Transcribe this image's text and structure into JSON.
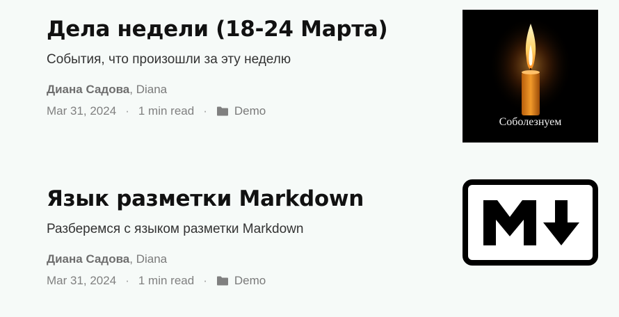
{
  "posts": [
    {
      "title": "Дела недели (18-24 Марта)",
      "summary": "События, что произошли за эту неделю",
      "author_main": "Диана Садова",
      "author_rest": ", Diana",
      "date": "Mar 31, 2024",
      "read_time": "1 min read",
      "separator": "·",
      "category": "Demo",
      "thumbnail": {
        "icon": "candle-icon",
        "caption": "Соболезнуем"
      }
    },
    {
      "title": "Язык разметки Markdown",
      "summary": "Разберемся с языком разметки Markdown",
      "author_main": "Диана Садова",
      "author_rest": ", Diana",
      "date": "Mar 31, 2024",
      "read_time": "1 min read",
      "separator": "·",
      "category": "Demo",
      "thumbnail": {
        "icon": "markdown-logo-icon"
      }
    }
  ],
  "colors": {
    "background": "#f6faf8",
    "title": "#111111",
    "meta": "#808080",
    "flame": "#ffd36a",
    "candle": "#e88a1a"
  }
}
